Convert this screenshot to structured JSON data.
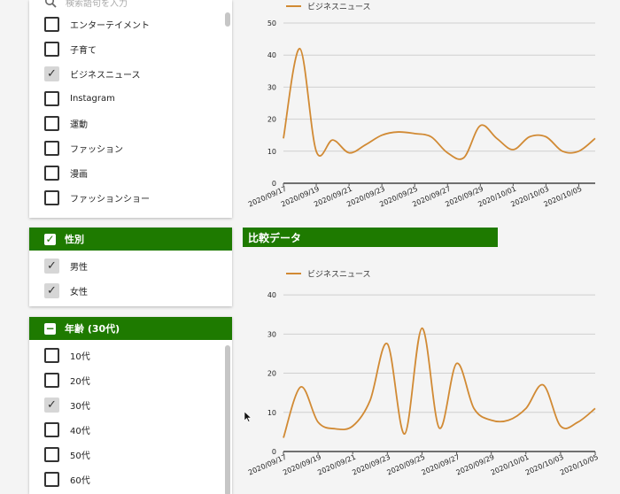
{
  "filter_panel": {
    "search_placeholder": "検索語句を入力",
    "items": [
      {
        "label": "エンターテイメント",
        "checked": false
      },
      {
        "label": "子育て",
        "checked": false
      },
      {
        "label": "ビジネスニュース",
        "checked": true
      },
      {
        "label": "Instagram",
        "checked": false
      },
      {
        "label": "運動",
        "checked": false
      },
      {
        "label": "ファッション",
        "checked": false
      },
      {
        "label": "漫画",
        "checked": false
      },
      {
        "label": "ファッションショー",
        "checked": false
      }
    ]
  },
  "gender_panel": {
    "title": "性別",
    "items": [
      {
        "label": "男性",
        "checked": true
      },
      {
        "label": "女性",
        "checked": true
      }
    ]
  },
  "age_panel": {
    "title": "年齢 (30代)",
    "items": [
      {
        "label": "10代",
        "checked": false
      },
      {
        "label": "20代",
        "checked": false
      },
      {
        "label": "30代",
        "checked": true
      },
      {
        "label": "40代",
        "checked": false
      },
      {
        "label": "50代",
        "checked": false
      },
      {
        "label": "60代",
        "checked": false
      }
    ]
  },
  "comparison_title": "比較データ",
  "colors": {
    "accent_green": "#1e7a00",
    "line_orange": "#d18a34"
  },
  "chart_data": [
    {
      "type": "line",
      "series": [
        {
          "name": "ビジネスニュース",
          "values": [
            14,
            42,
            10,
            13.5,
            9.5,
            12,
            15,
            16,
            15.5,
            14.5,
            9.5,
            8,
            18,
            14,
            10.5,
            14.5,
            14.5,
            10,
            10,
            14
          ]
        }
      ],
      "x": [
        "2020/09/17",
        "2020/09/18",
        "2020/09/19",
        "2020/09/20",
        "2020/09/21",
        "2020/09/22",
        "2020/09/23",
        "2020/09/24",
        "2020/09/25",
        "2020/09/26",
        "2020/09/27",
        "2020/09/28",
        "2020/09/29",
        "2020/09/30",
        "2020/10/01",
        "2020/10/02",
        "2020/10/03",
        "2020/10/04",
        "2020/10/05",
        "2020/10/06"
      ],
      "x_tick_labels": [
        "2020/09/17",
        "2020/09/19",
        "2020/09/21",
        "2020/09/23",
        "2020/09/25",
        "2020/09/27",
        "2020/09/29",
        "2020/10/01",
        "2020/10/03",
        "2020/10/05"
      ],
      "ylim": [
        0,
        50
      ],
      "y_ticks": [
        0,
        10,
        20,
        30,
        40,
        50
      ],
      "grid": true,
      "legend": "top-left"
    },
    {
      "type": "line",
      "series": [
        {
          "name": "ビジネスニュース",
          "values": [
            3.5,
            16.5,
            7.5,
            5.8,
            6.5,
            13,
            27.5,
            4.5,
            31.5,
            6,
            22.5,
            11,
            8,
            8,
            11,
            17,
            6.5,
            7.5,
            11
          ]
        }
      ],
      "x": [
        "2020/09/17",
        "2020/09/18",
        "2020/09/19",
        "2020/09/20",
        "2020/09/21",
        "2020/09/22",
        "2020/09/23",
        "2020/09/24",
        "2020/09/25",
        "2020/09/26",
        "2020/09/27",
        "2020/09/28",
        "2020/09/29",
        "2020/09/30",
        "2020/10/01",
        "2020/10/02",
        "2020/10/03",
        "2020/10/04",
        "2020/10/05"
      ],
      "x_tick_labels": [
        "2020/09/17",
        "2020/09/19",
        "2020/09/21",
        "2020/09/23",
        "2020/09/25",
        "2020/09/27",
        "2020/09/29",
        "2020/10/01",
        "2020/10/03",
        "2020/10/05"
      ],
      "ylim": [
        0,
        45
      ],
      "y_ticks": [
        0,
        10,
        20,
        30,
        40
      ],
      "grid": true,
      "legend": "top-left"
    }
  ]
}
